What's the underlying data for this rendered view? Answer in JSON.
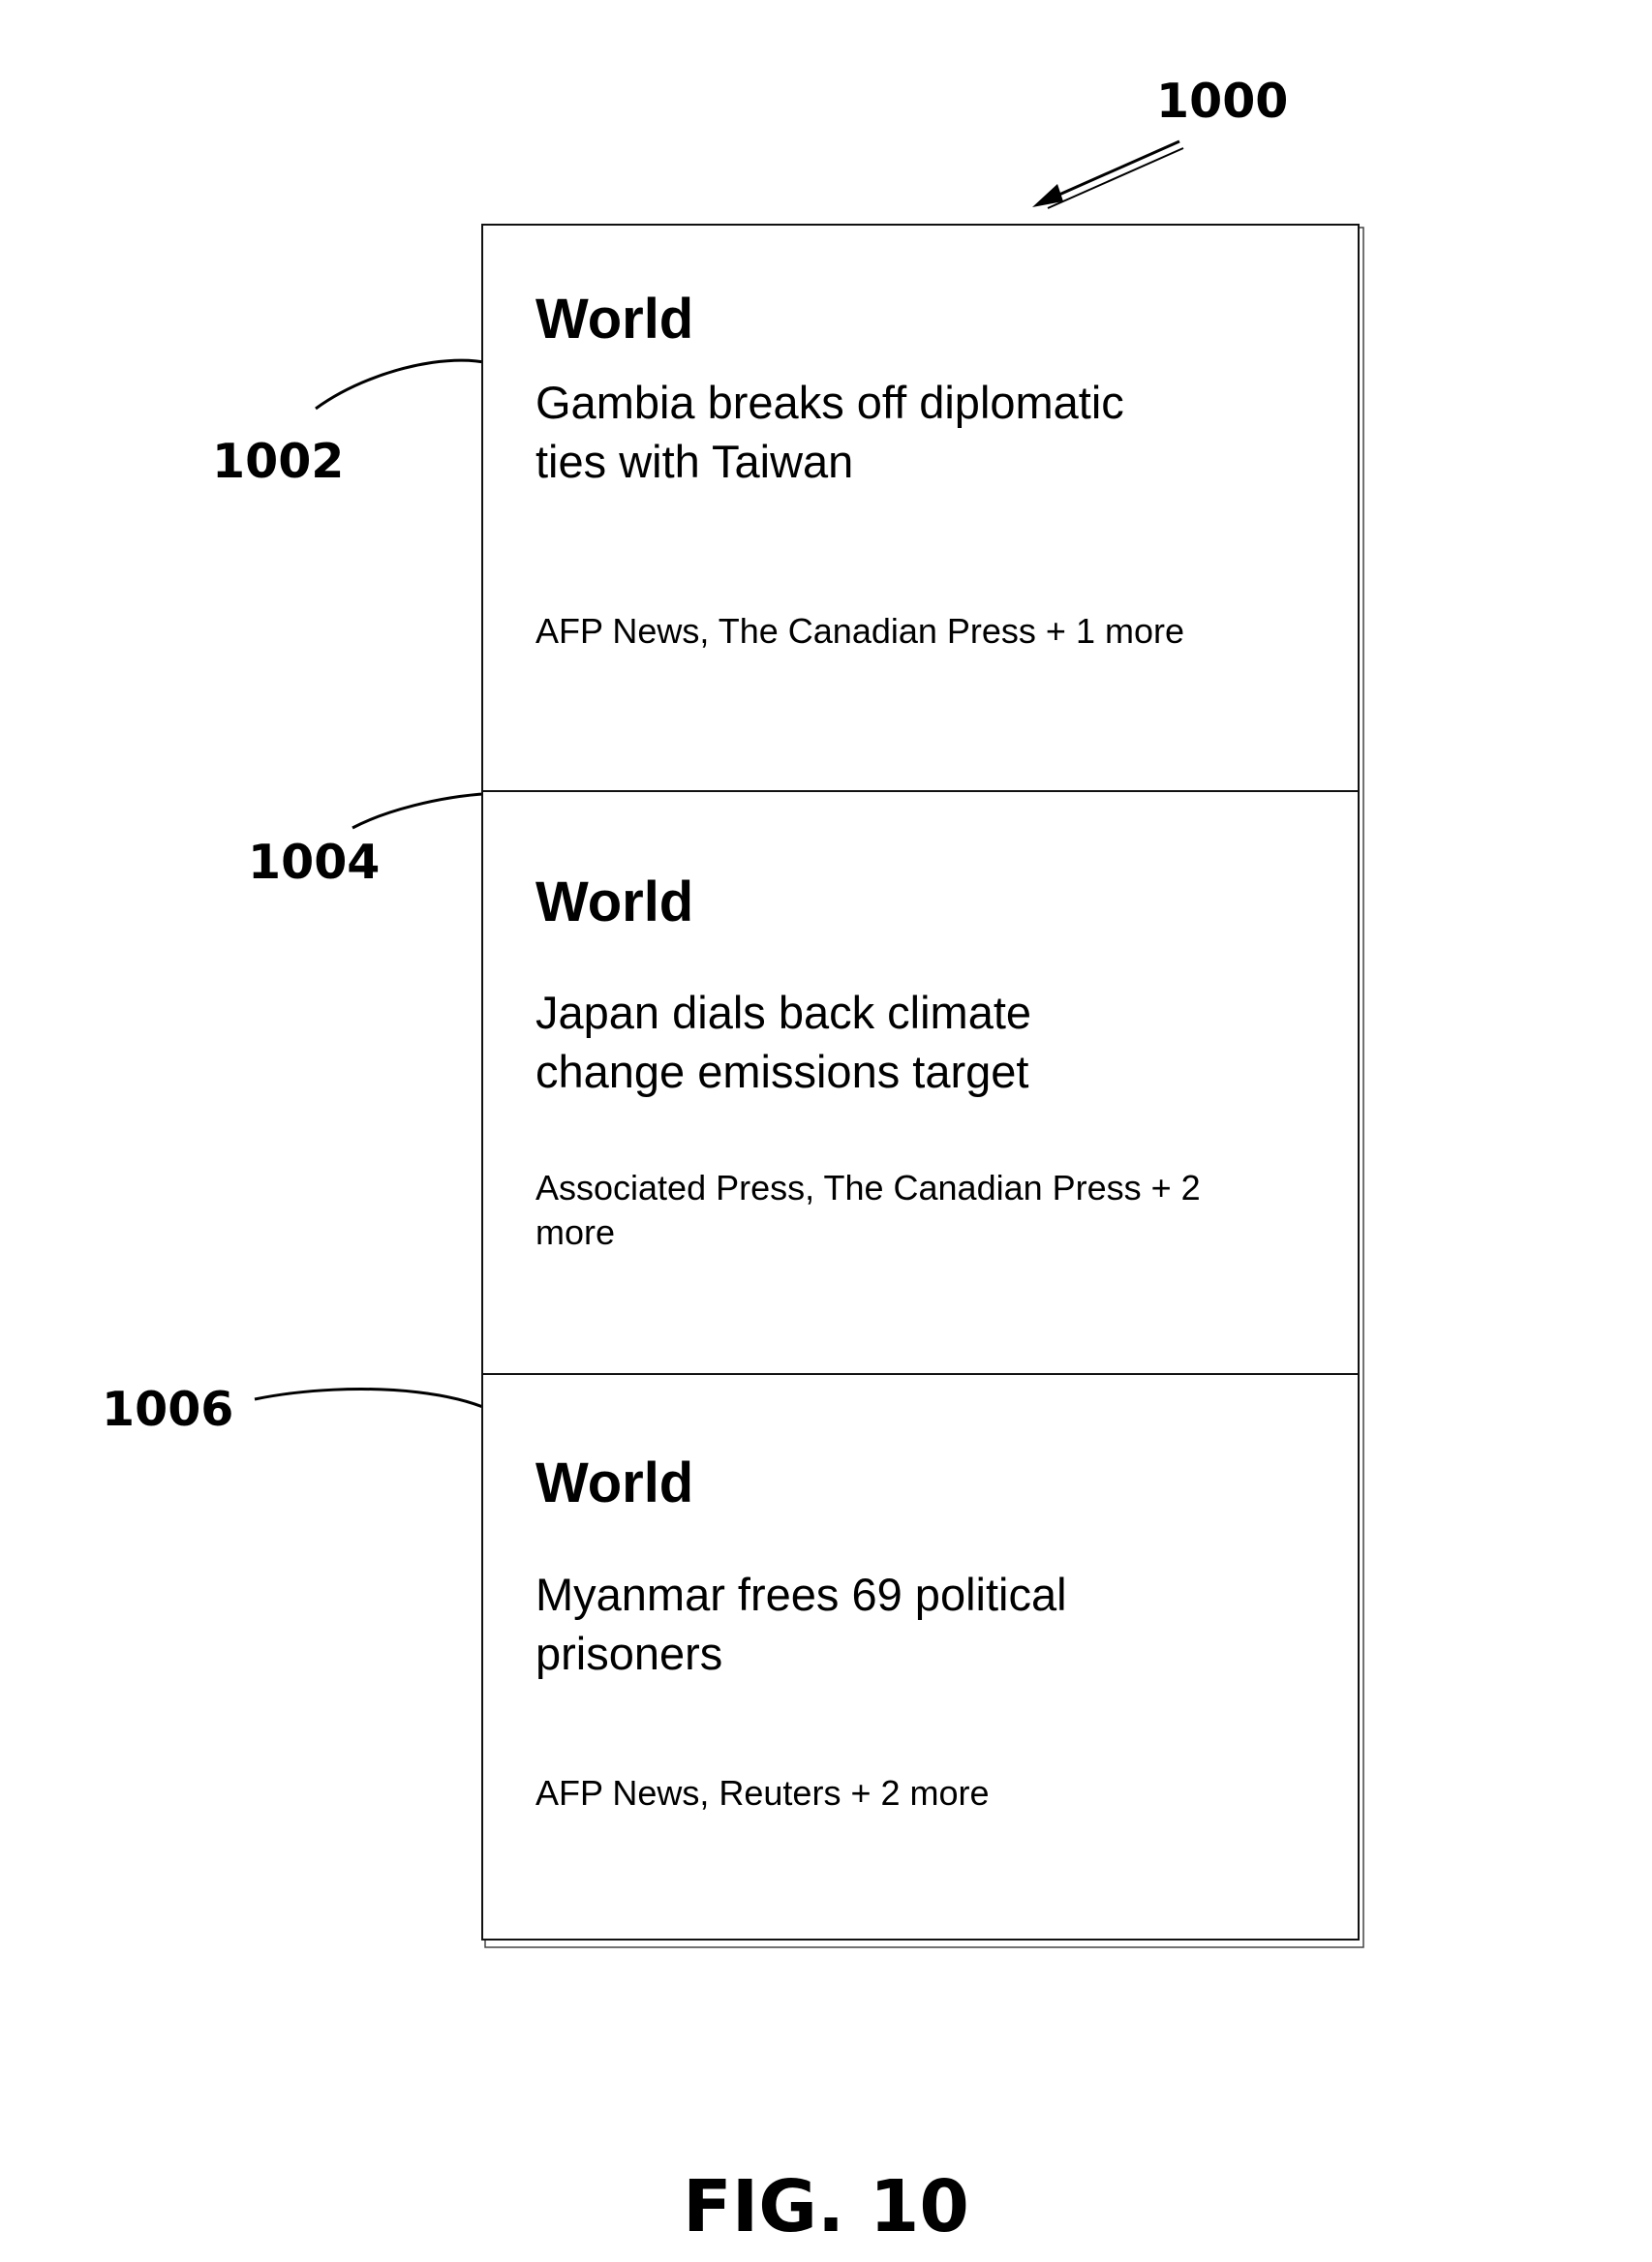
{
  "figure": {
    "label": "FIG. 10",
    "refs": {
      "panel": "1000",
      "card1": "1002",
      "card2": "1004",
      "card3": "1006"
    }
  },
  "cards": [
    {
      "category": "World",
      "headline": "Gambia breaks off diplomatic ties with Taiwan",
      "sources": "AFP News, The Canadian Press + 1 more"
    },
    {
      "category": "World",
      "headline": "Japan dials back climate change emissions target",
      "sources": "Associated Press, The Canadian Press + 2 more"
    },
    {
      "category": "World",
      "headline": "Myanmar frees 69 political prisoners",
      "sources": "AFP News, Reuters + 2 more"
    }
  ]
}
